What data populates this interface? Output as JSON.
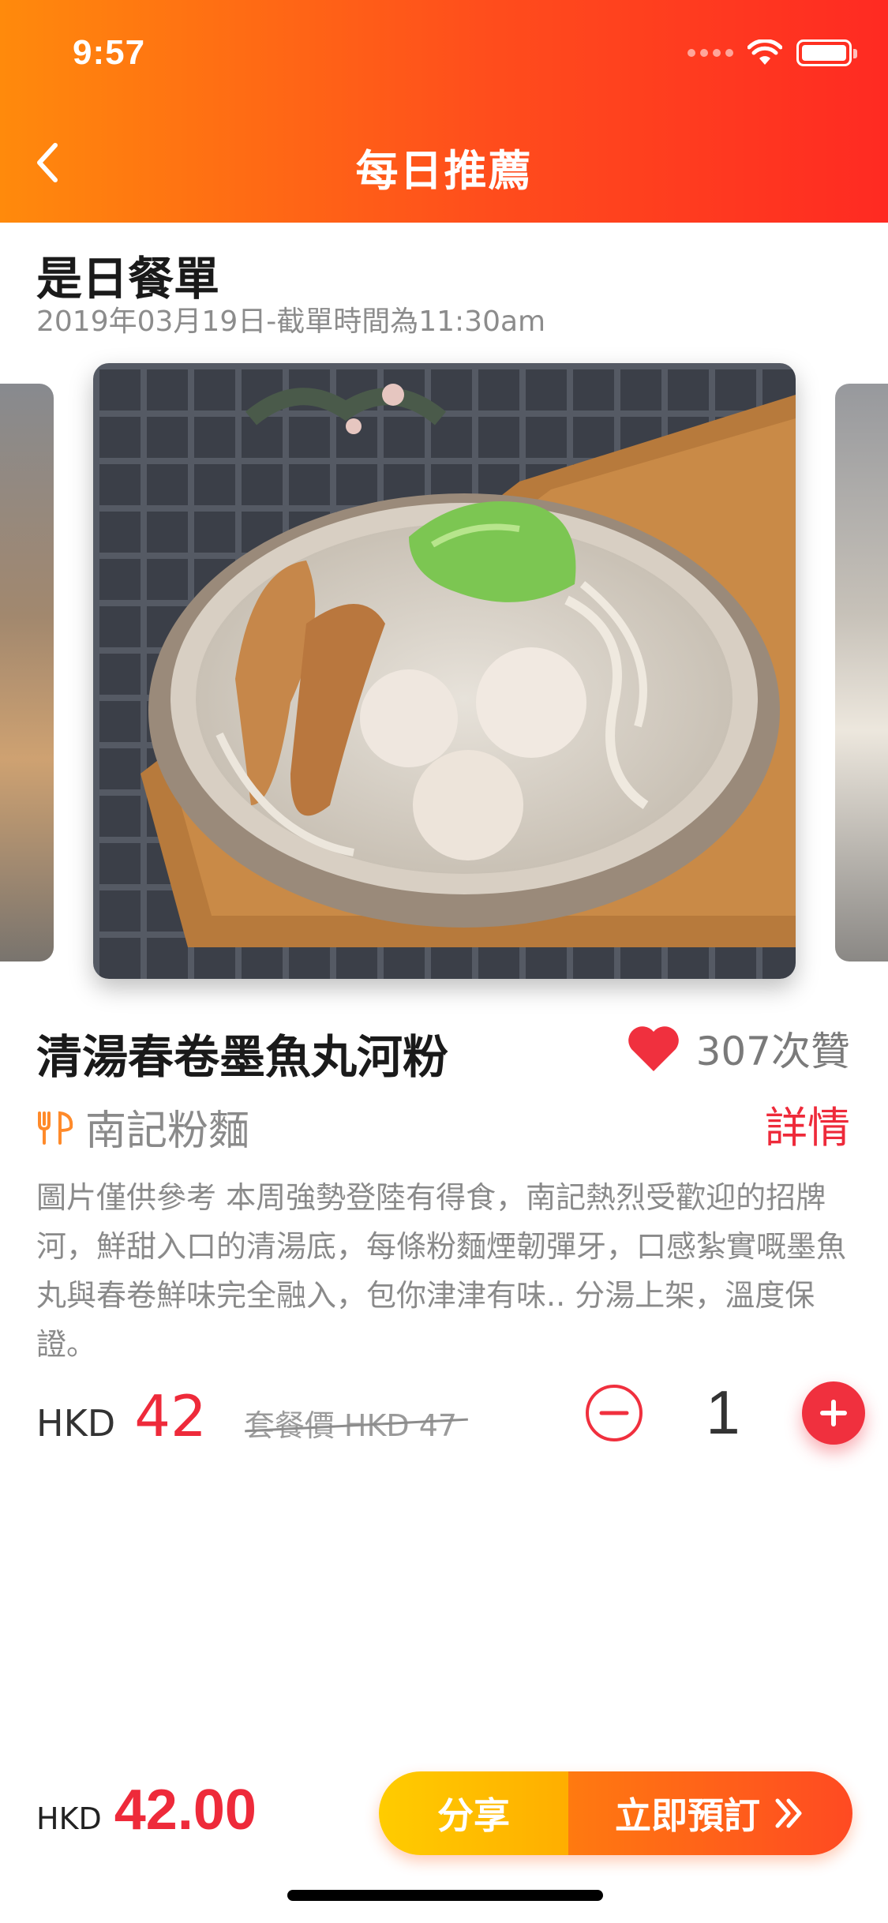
{
  "status_bar": {
    "time": "9:57"
  },
  "header": {
    "title": "每日推薦"
  },
  "section": {
    "title": "是日餐單",
    "subtitle": "2019年03月19日-截單時間為11:30am"
  },
  "dish": {
    "name": "清湯春卷墨魚丸河粉",
    "likes": "307次贊",
    "restaurant": "南記粉麵",
    "detail_label": "詳情",
    "description": "圖片僅供參考  本周強勢登陸有得食，南記熱烈受歡迎的招牌河，鮮甜入口的清湯底，每條粉麵煙韌彈牙，口感紮實嘅墨魚丸與春卷鮮味完全融入，包你津津有味.. 分湯上架，溫度保證。"
  },
  "price": {
    "currency": "HKD",
    "value": "42",
    "set_price": "套餐價 HKD 47"
  },
  "quantity": {
    "value": "1"
  },
  "footer": {
    "total_currency": "HKD",
    "total_value": "42.00",
    "share_label": "分享",
    "order_label": "立即預訂"
  },
  "colors": {
    "header_start": "#ff8a0c",
    "header_end": "#ff2a22",
    "accent_red": "#ee2a3a",
    "share_yellow": "#ffb800"
  },
  "icons": [
    "back-icon",
    "wifi-icon",
    "battery-icon",
    "heart-icon",
    "fork-knife-icon",
    "minus-icon",
    "plus-icon",
    "double-chevron-right-icon"
  ]
}
